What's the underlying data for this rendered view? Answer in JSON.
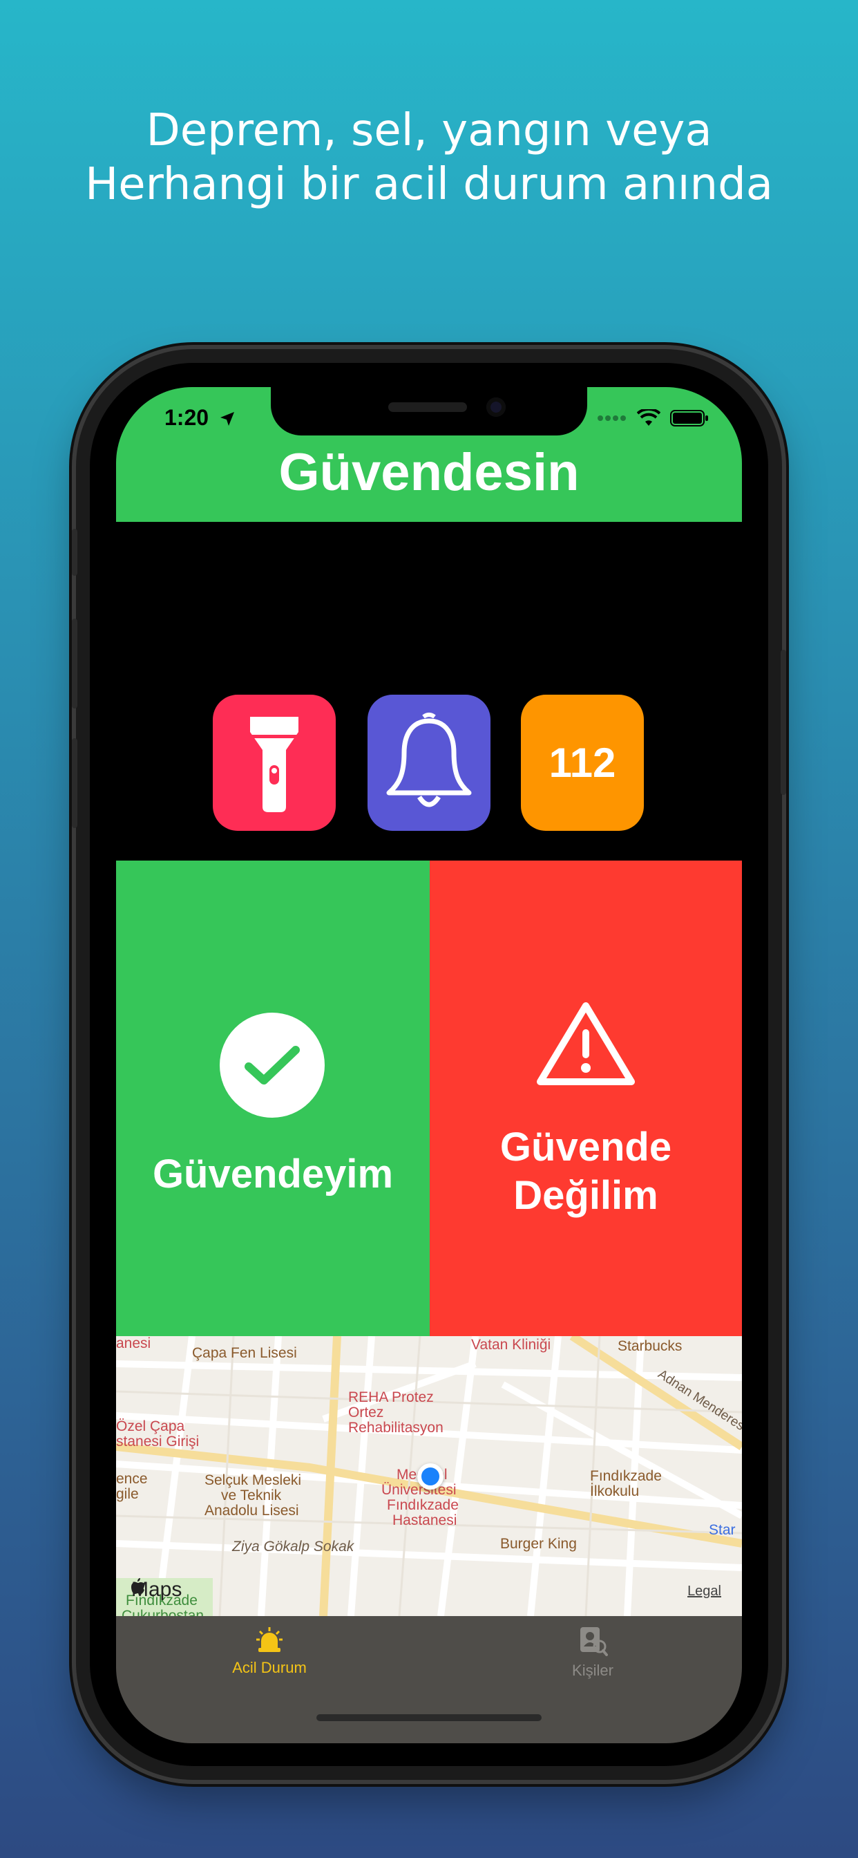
{
  "promo": {
    "line1": "Deprem, sel, yangın veya",
    "line2": "Herhangi bir acil durum anında"
  },
  "status_bar": {
    "time": "1:20",
    "icons": [
      "location-arrow-icon",
      "cellular-signal-icon",
      "wifi-icon",
      "battery-icon"
    ]
  },
  "header": {
    "title": "Güvendesin"
  },
  "tools": [
    {
      "icon": "flashlight-icon",
      "color": "#fe2d55"
    },
    {
      "icon": "bell-icon",
      "color": "#5957d5"
    },
    {
      "label": "112",
      "color": "#fe9500"
    }
  ],
  "panels": {
    "safe": {
      "label": "Güvendeyim",
      "color": "#36c659",
      "icon": "checkmark-icon"
    },
    "unsafe": {
      "line1": "Güvende",
      "line2": "Değilim",
      "color": "#fe3a30",
      "icon": "warning-icon"
    }
  },
  "map": {
    "labels": {
      "anesi": "anesi",
      "capa": "Çapa Fen Lisesi",
      "vatan": "Vatan Kliniği",
      "starbucks": "Starbucks",
      "adnan": "Adnan Menderes Bu",
      "reha1": "REHA Protez",
      "reha2": "Ortez",
      "reha3": "Rehabilitasyon",
      "ozel1": "Özel Çapa",
      "ozel2": "stanesi Girişi",
      "selcuk1": "Selçuk Mesleki",
      "selcuk2": "ve Teknik",
      "selcuk3": "Anadolu Lisesi",
      "ence": "ence",
      "gile": "gile",
      "medipol1": "Medipol",
      "medipol2": "Üniversitesi",
      "medipol3": "Fındıkzade",
      "medipol4": "Hastanesi",
      "fin1": "Fındıkzade",
      "fin2": "İlkokulu",
      "burger": "Burger King",
      "star": "Star",
      "ziya": "Ziya Gökalp Sokak",
      "findpark": "Fındıkzade",
      "cukur": "Çukurbostan"
    },
    "logo": "Maps",
    "legal": "Legal"
  },
  "tabbar": {
    "items": [
      {
        "label": "Acil Durum",
        "icon": "siren-icon",
        "active": true
      },
      {
        "label": "Kişiler",
        "icon": "contacts-search-icon",
        "active": false
      }
    ],
    "active_color": "#f4c416",
    "inactive_color": "#8d8b87"
  }
}
